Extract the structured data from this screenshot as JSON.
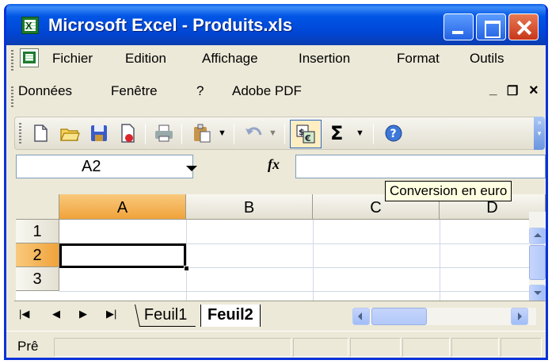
{
  "window": {
    "title": "Microsoft Excel - Produits.xls"
  },
  "menubar": {
    "items": [
      "Fichier",
      "Edition",
      "Affichage",
      "Insertion",
      "Format",
      "Outils",
      "Données",
      "Fenêtre",
      "?",
      "Adobe PDF"
    ],
    "mdi_min": "_",
    "mdi_restore": "❐",
    "mdi_close": "×"
  },
  "toolbar": {
    "icons": [
      "new-icon",
      "open-icon",
      "save-icon",
      "permission-icon",
      "print-icon",
      "paste-icon",
      "undo-icon",
      "euro-conversion-icon",
      "autosum-icon",
      "help-icon"
    ],
    "sigma": "Σ",
    "tooltip": "Conversion en euro"
  },
  "formulabar": {
    "name_box": "A2",
    "fx": "fx",
    "formula": ""
  },
  "grid": {
    "columns": [
      "A",
      "B",
      "C",
      "D"
    ],
    "rows": [
      "1",
      "2",
      "3"
    ],
    "active_cell": "A2"
  },
  "sheets": {
    "tabs": [
      "Feuil1",
      "Feuil2"
    ],
    "active": "Feuil2"
  },
  "status": {
    "text": "Prê"
  },
  "colors": {
    "title_bar": "#0046d5",
    "active_header": "#f0a33b",
    "tooltip_bg": "#ffffe1"
  }
}
